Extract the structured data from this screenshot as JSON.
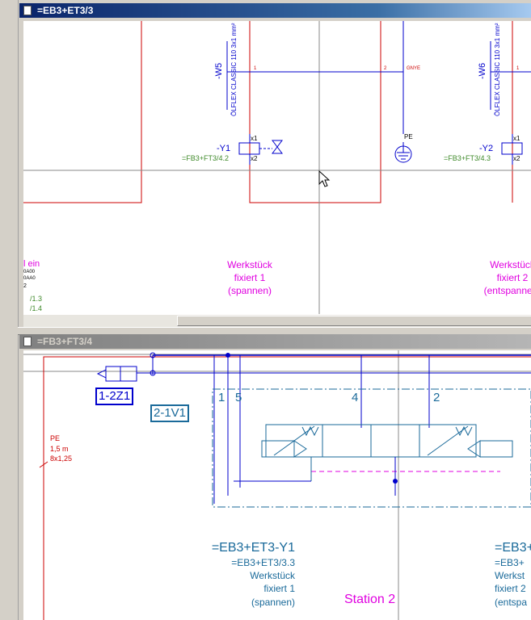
{
  "window1": {
    "title": "=EB3+ET3/3",
    "cable_w5": {
      "tag": "-W5",
      "name": "ÖLFLEX CLASSIC 110 3x1 mm²",
      "wire_1": "1",
      "wire_2": "2",
      "wire_gnye": "GNYE"
    },
    "cable_w6": {
      "tag": "-W6",
      "name": "ÖLFLEX CLASSIC 110 3x1 mm²",
      "wire_1": "1"
    },
    "valve_y1": {
      "tag": "-Y1",
      "x1": "x1",
      "x2": "x2",
      "ref": "=FB3+FT3/4.2"
    },
    "valve_y2": {
      "tag": "-Y2",
      "x1": "x1",
      "x2": "x2",
      "ref": "=FB3+FT3/4.3"
    },
    "pe_label": "PE",
    "text_y1": [
      "Werkstück",
      "fixiert 1",
      "(spannen)"
    ],
    "text_y2": [
      "Werkstück",
      "fixiert 2",
      "(entspannen)"
    ],
    "left_fragment": {
      "t1": "l ein",
      "t2": "0A00",
      "t3": "0AA0",
      "t4": "2",
      "r1": "/1.3",
      "r2": "/1.4"
    }
  },
  "window2": {
    "title": "=FB3+FT3/4",
    "cylinder_label": "1-2Z1",
    "valve_label": "2-1V1",
    "port_1": "1",
    "port_5": "5",
    "port_4": "4",
    "port_2": "2",
    "pe_cable": {
      "l1": "PE",
      "l2": "1,5 m",
      "l3": "8x1,25"
    },
    "y1_block": {
      "title": "=EB3+ET3-Y1",
      "ref": "=EB3+ET3/3.3",
      "l1": "Werkstück",
      "l2": "fixiert 1",
      "l3": "(spannen)"
    },
    "y2_block": {
      "title": "=EB3+",
      "ref": "=EB3+",
      "l1": "Werkst",
      "l2": "fixiert 2",
      "l3": "(entspa"
    },
    "station": "Station 2"
  },
  "colors": {
    "red": "#cc0000",
    "blue": "#0000cc",
    "magenta": "#e000e0",
    "green": "#3f8a2a",
    "teal": "#1a6a9a"
  }
}
